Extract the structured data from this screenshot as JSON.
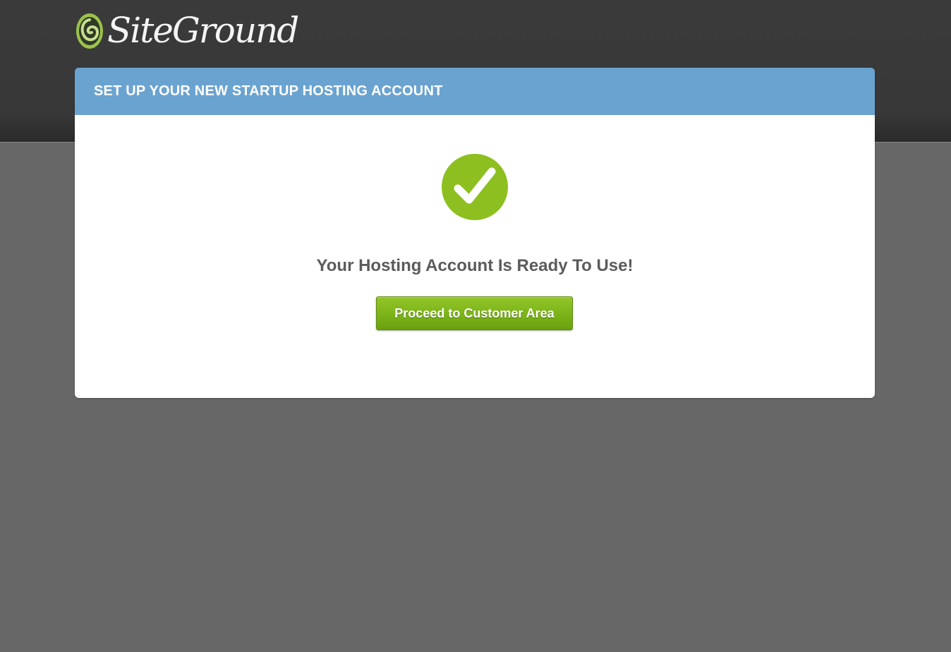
{
  "brand": {
    "name": "SiteGround",
    "logo_icon": "siteground-swirl-icon",
    "accent_color": "#86bd1f"
  },
  "panel": {
    "title": "SET UP YOUR NEW STARTUP HOSTING ACCOUNT",
    "header_color": "#6aa3d0",
    "status_icon": "checkmark-circle-icon",
    "message": "Your Hosting Account Is Ready To Use!",
    "button_label": "Proceed to Customer Area"
  }
}
